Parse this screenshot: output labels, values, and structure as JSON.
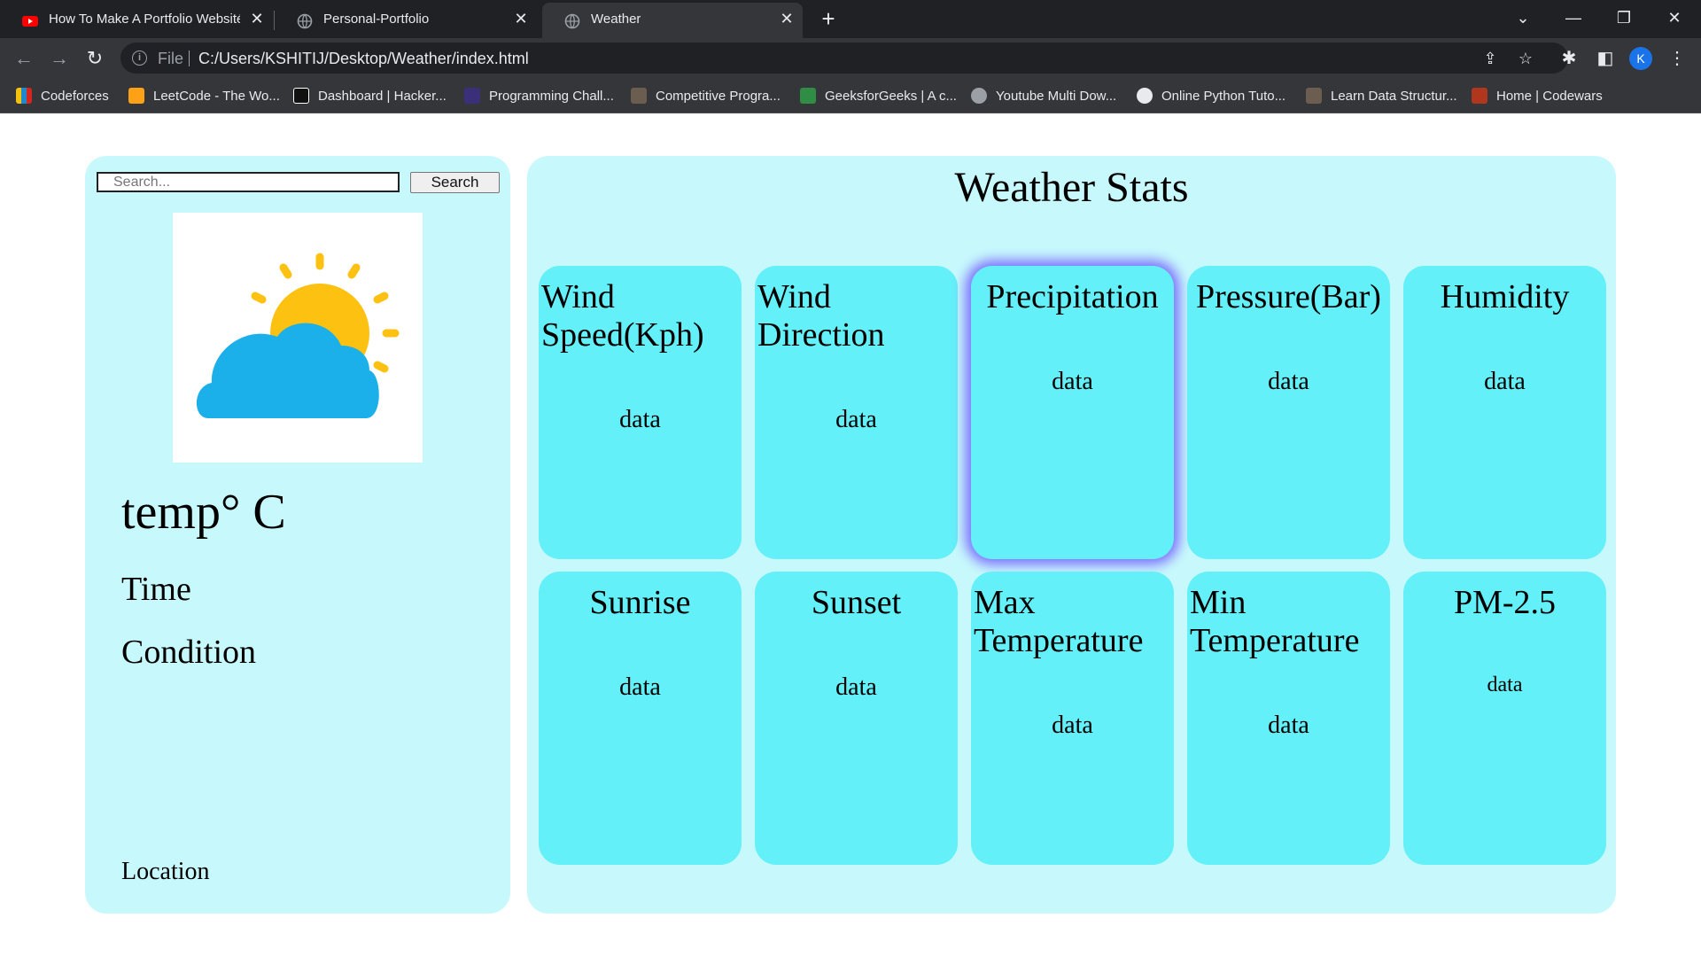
{
  "browser": {
    "tabs": [
      {
        "title": "How To Make A Portfolio Websité",
        "favicon": "youtube-icon",
        "active": false
      },
      {
        "title": "Personal-Portfolio",
        "favicon": "globe-icon",
        "active": false
      },
      {
        "title": "Weather",
        "favicon": "globe-icon",
        "active": true
      }
    ],
    "address": {
      "scheme": "File",
      "url": "C:/Users/KSHITIJ/Desktop/Weather/index.html"
    },
    "profile_initial": "K",
    "bookmarks": [
      {
        "label": "Codeforces",
        "icon": "codeforces-icon",
        "color": "#1f8acb"
      },
      {
        "label": "LeetCode - The Wo...",
        "icon": "leetcode-icon",
        "color": "#ffa116"
      },
      {
        "label": "Dashboard | Hacker...",
        "icon": "hackerrank-icon",
        "color": "#111111"
      },
      {
        "label": "Programming Chall...",
        "icon": "codechef-icon",
        "color": "#3b2f7a"
      },
      {
        "label": "Competitive Progra...",
        "icon": "cc-icon",
        "color": "#6b5e50"
      },
      {
        "label": "GeeksforGeeks | A c...",
        "icon": "gfg-icon",
        "color": "#2f8d46"
      },
      {
        "label": "Youtube Multi Dow...",
        "icon": "globe-icon",
        "color": "#9aa0a6"
      },
      {
        "label": "Online Python Tuto...",
        "icon": "wordpress-icon",
        "color": "#e8eaed"
      },
      {
        "label": "Learn Data Structur...",
        "icon": "cc-icon",
        "color": "#6b5e50"
      },
      {
        "label": "Home | Codewars",
        "icon": "codewars-icon",
        "color": "#b1361e"
      }
    ]
  },
  "page": {
    "search": {
      "placeholder": "Search...",
      "button": "Search"
    },
    "weather_icon": "partly-cloudy-icon",
    "temp": "temp° C",
    "time": "Time",
    "condition": "Condition",
    "location": "Location",
    "stats_title": "Weather Stats",
    "cards": [
      {
        "title": "Wind Speed(Kph)",
        "data": "data"
      },
      {
        "title": "Wind Direction",
        "data": "data"
      },
      {
        "title": "Precipitation",
        "data": "data"
      },
      {
        "title": "Pressure(Bar)",
        "data": "data"
      },
      {
        "title": "Humidity",
        "data": "data"
      },
      {
        "title": "Sunrise",
        "data": "data"
      },
      {
        "title": "Sunset",
        "data": "data"
      },
      {
        "title": "Max Temperature",
        "data": "data"
      },
      {
        "title": "Min Temperature",
        "data": "data"
      },
      {
        "title": "PM-2.5",
        "data": "data"
      }
    ],
    "colors": {
      "panel": "#c7f9fc",
      "card": "#64f0f8",
      "glow": "#7b6bff",
      "sun": "#fcc111",
      "cloud": "#1cb0ea"
    }
  }
}
